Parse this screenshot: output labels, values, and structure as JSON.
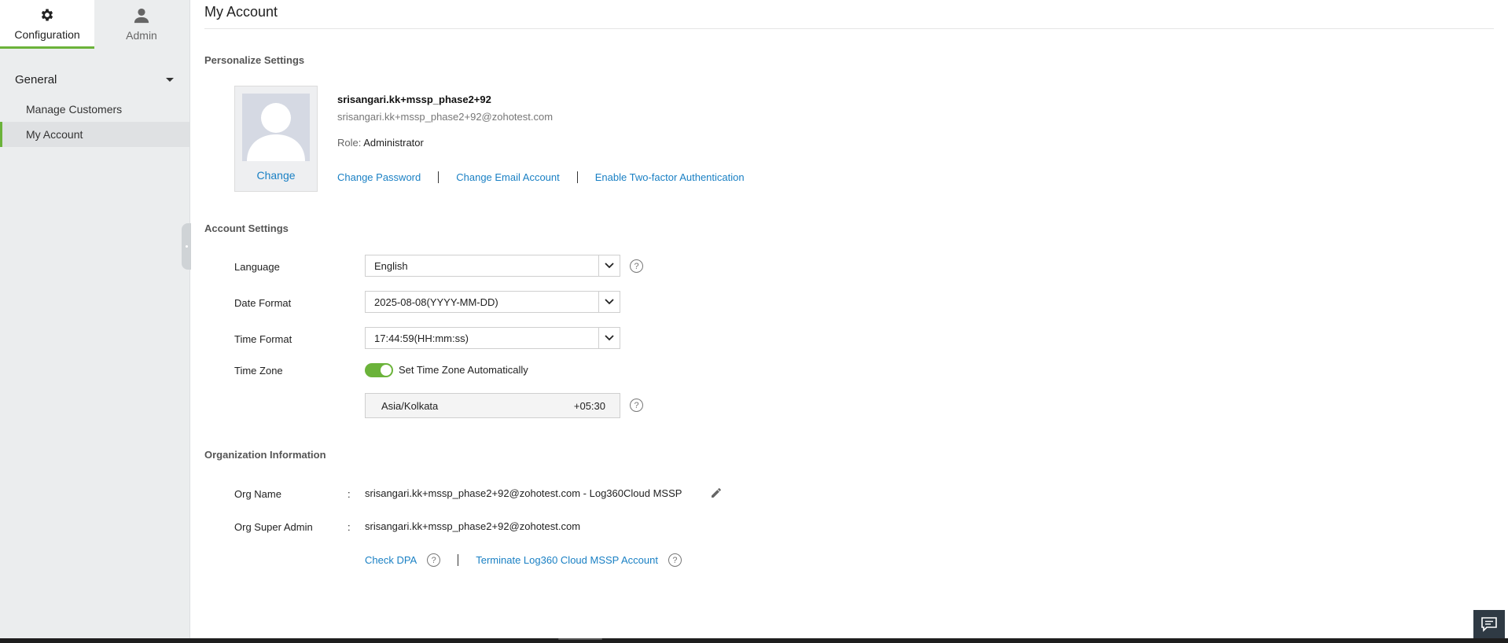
{
  "topnav": {
    "tabs": [
      {
        "label": "Configuration",
        "icon": "gear-icon",
        "active": true
      },
      {
        "label": "Admin",
        "icon": "user-icon",
        "active": false
      }
    ]
  },
  "sidebar": {
    "group_label": "General",
    "items": [
      {
        "label": "Manage Customers",
        "active": false
      },
      {
        "label": "My Account",
        "active": true
      }
    ]
  },
  "page": {
    "title": "My Account"
  },
  "personalize": {
    "section_title": "Personalize Settings",
    "avatar_change_label": "Change",
    "user_name": "srisangari.kk+mssp_phase2+92",
    "user_email": "srisangari.kk+mssp_phase2+92@zohotest.com",
    "role_label": "Role:",
    "role_value": "Administrator",
    "links": {
      "change_password": "Change Password",
      "change_email": "Change Email Account",
      "two_factor": "Enable Two-factor Authentication"
    }
  },
  "account": {
    "section_title": "Account Settings",
    "language_label": "Language",
    "language_value": "English",
    "date_format_label": "Date Format",
    "date_format_value": "2025-08-08(YYYY-MM-DD)",
    "time_format_label": "Time Format",
    "time_format_value": "17:44:59(HH:mm:ss)",
    "time_zone_label": "Time Zone",
    "auto_tz_label": "Set Time Zone Automatically",
    "auto_tz_enabled": true,
    "tz_name": "Asia/Kolkata",
    "tz_offset": "+05:30",
    "help_glyph": "?"
  },
  "org": {
    "section_title": "Organization Information",
    "name_label": "Org Name",
    "name_value": "srisangari.kk+mssp_phase2+92@zohotest.com - Log360Cloud MSSP",
    "super_admin_label": "Org Super Admin",
    "super_admin_value": "srisangari.kk+mssp_phase2+92@zohotest.com",
    "colon": ":",
    "check_dpa_label": "Check DPA",
    "terminate_label": "Terminate Log360 Cloud MSSP Account"
  },
  "colors": {
    "accent_green": "#6bb33a",
    "link_blue": "#1a80c4",
    "sidebar_bg": "#ebedee"
  }
}
